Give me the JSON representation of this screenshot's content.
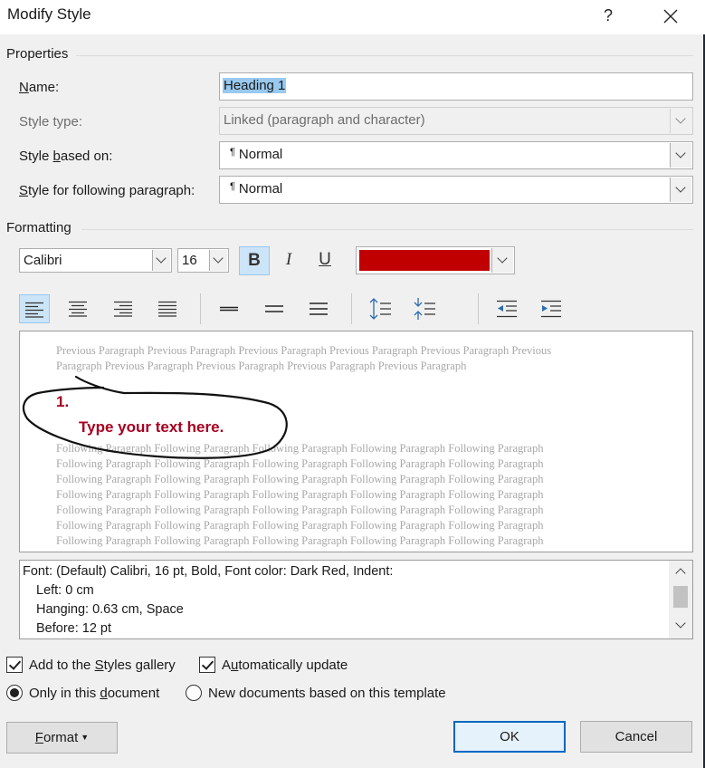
{
  "window": {
    "title": "Modify Style",
    "help": "?",
    "close": "✕"
  },
  "properties": {
    "heading": "Properties",
    "name_label": "Name:",
    "name_value": "Heading 1",
    "style_type_label": "Style type:",
    "style_type_value": "Linked (paragraph and character)",
    "based_on_label": "Style based on:",
    "based_on_value": "Normal",
    "following_label": "Style for following paragraph:",
    "following_value": "Normal"
  },
  "formatting": {
    "heading": "Formatting",
    "font": "Calibri",
    "size": "16",
    "bold": "B",
    "italic": "I",
    "underline": "U",
    "color": "#c00000"
  },
  "preview": {
    "previous_line1": "Previous Paragraph Previous Paragraph Previous Paragraph Previous Paragraph Previous Paragraph Previous",
    "previous_line2": "Paragraph Previous Paragraph Previous Paragraph Previous Paragraph Previous Paragraph",
    "number": "1.",
    "sample_text": "Type your text here.",
    "following_line": "Following Paragraph Following Paragraph Following Paragraph Following Paragraph Following Paragraph",
    "accent_color": "#a50021"
  },
  "description": {
    "line1": "Font: (Default) Calibri, 16 pt, Bold, Font color: Dark Red, Indent:",
    "line2": "Left:  0 cm",
    "line3": "Hanging:  0.63 cm, Space",
    "line4": "Before:  12 pt"
  },
  "options": {
    "add_gallery_label": "Add to the Styles gallery",
    "auto_update_label": "Automatically update",
    "only_doc_label": "Only in this document",
    "new_docs_label": "New documents based on this template"
  },
  "buttons": {
    "format": "Format",
    "ok": "OK",
    "cancel": "Cancel"
  }
}
